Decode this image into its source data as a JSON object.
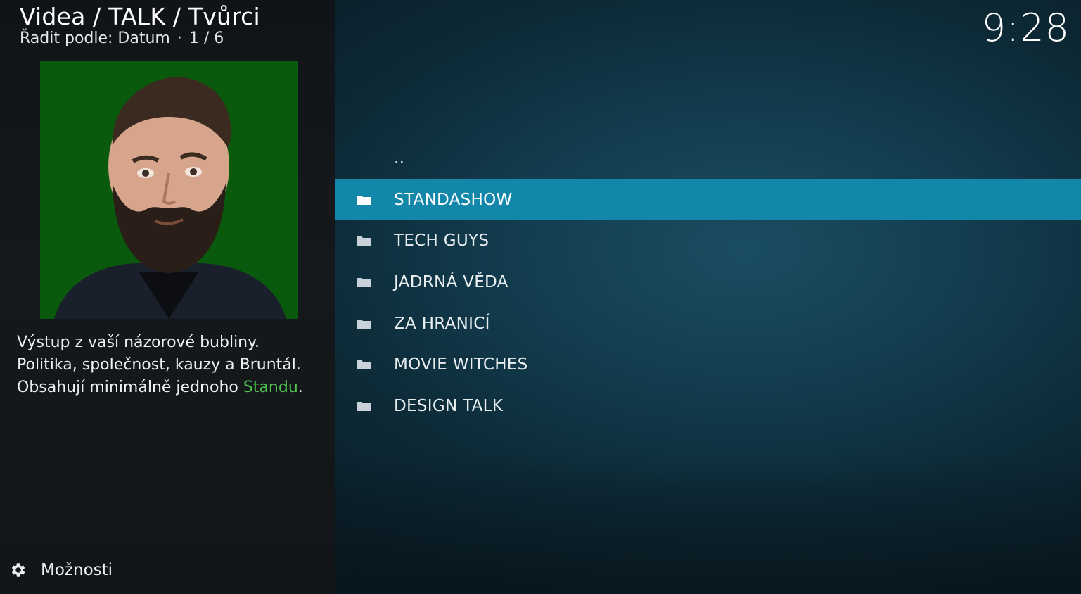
{
  "header": {
    "breadcrumb": "Videa / TALK / Tvůrci",
    "sort_label": "Řadit podle: Datum",
    "separator": "·",
    "position": "1 / 6",
    "clock": "9:28"
  },
  "info": {
    "plot_line1": "Výstup z vaší názorové bubliny.",
    "plot_line2": "Politika, společnost, kauzy a Bruntál.",
    "plot_line3_prefix": "Obsahují minimálně jednoho ",
    "plot_line3_highlight": "Standu",
    "plot_line3_suffix": "."
  },
  "footer": {
    "options_label": "Možnosti"
  },
  "list": {
    "parent_item": "..",
    "items": [
      {
        "label": "STANDASHOW",
        "selected": true
      },
      {
        "label": "TECH GUYS"
      },
      {
        "label": "JADRNÁ VĚDA"
      },
      {
        "label": "ZA HRANICÍ"
      },
      {
        "label": "MOVIE WITCHES"
      },
      {
        "label": "DESIGN TALK"
      }
    ]
  },
  "colors": {
    "selection": "#1287aa",
    "highlight_text": "#4fc24f",
    "portrait_background": "#0a5a0d"
  },
  "icons": {
    "folder": "folder-icon",
    "options": "gear-icon"
  }
}
